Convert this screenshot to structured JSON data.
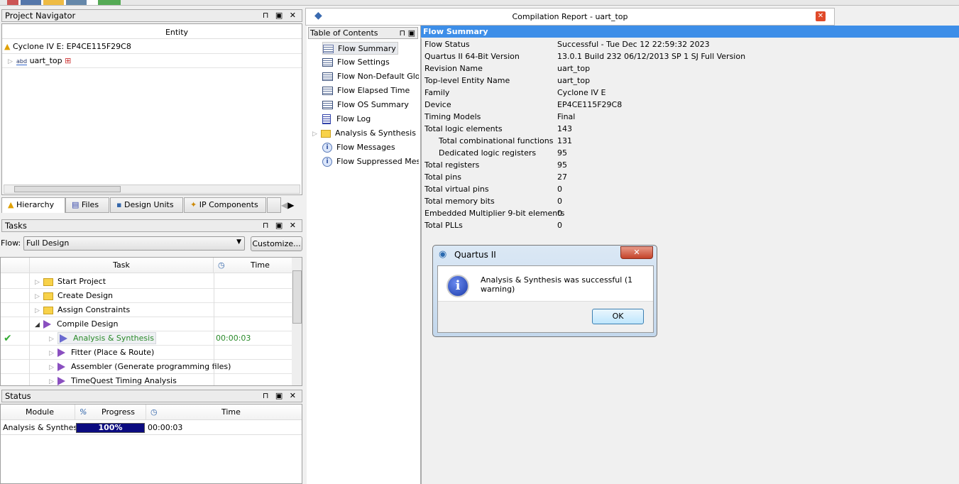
{
  "project_navigator": {
    "title": "Project Navigator",
    "column": "Entity",
    "device": "Cyclone IV E: EP4CE115F29C8",
    "top_entity": "uart_top"
  },
  "nav_tabs": [
    "Hierarchy",
    "Files",
    "Design Units",
    "IP Components"
  ],
  "tasks": {
    "title": "Tasks",
    "flow_label": "Flow:",
    "flow_value": "Full Design",
    "customize": "Customize...",
    "col_task": "Task",
    "col_time": "Time",
    "rows": [
      {
        "label": "Start Project",
        "time": ""
      },
      {
        "label": "Create Design",
        "time": ""
      },
      {
        "label": "Assign Constraints",
        "time": ""
      },
      {
        "label": "Compile Design",
        "time": ""
      },
      {
        "label": "Analysis & Synthesis",
        "time": "00:00:03"
      },
      {
        "label": "Fitter (Place & Route)",
        "time": ""
      },
      {
        "label": "Assembler (Generate programming files)",
        "time": ""
      },
      {
        "label": "TimeQuest Timing Analysis",
        "time": ""
      }
    ]
  },
  "status": {
    "title": "Status",
    "col_module": "Module",
    "col_progress": "Progress",
    "col_time": "Time",
    "percent_symbol": "%",
    "module": "Analysis & Synthesis",
    "progress_text": "100%",
    "progress": 100,
    "time": "00:00:03"
  },
  "report": {
    "title": "Compilation Report - uart_top",
    "toc_title": "Table of Contents",
    "toc": [
      "Flow Summary",
      "Flow Settings",
      "Flow Non-Default Global",
      "Flow Elapsed Time",
      "Flow OS Summary",
      "Flow Log",
      "Analysis & Synthesis",
      "Flow Messages",
      "Flow Suppressed Messages"
    ],
    "summary_title": "Flow Summary",
    "summary": [
      [
        "Flow Status",
        "Successful - Tue Dec 12 22:59:32 2023"
      ],
      [
        "Quartus II 64-Bit Version",
        "13.0.1 Build 232 06/12/2013 SP 1 SJ Full Version"
      ],
      [
        "Revision Name",
        "uart_top"
      ],
      [
        "Top-level Entity Name",
        "uart_top"
      ],
      [
        "Family",
        "Cyclone IV E"
      ],
      [
        "Device",
        "EP4CE115F29C8"
      ],
      [
        "Timing Models",
        "Final"
      ],
      [
        "Total logic elements",
        "143"
      ],
      [
        "Total combinational functions",
        "131"
      ],
      [
        "Dedicated logic registers",
        "95"
      ],
      [
        "Total registers",
        "95"
      ],
      [
        "Total pins",
        "27"
      ],
      [
        "Total virtual pins",
        "0"
      ],
      [
        "Total memory bits",
        "0"
      ],
      [
        "Embedded Multiplier 9-bit elements",
        "0"
      ],
      [
        "Total PLLs",
        "0"
      ]
    ]
  },
  "dialog": {
    "title": "Quartus II",
    "message": "Analysis & Synthesis was successful (1 warning)",
    "ok": "OK"
  }
}
